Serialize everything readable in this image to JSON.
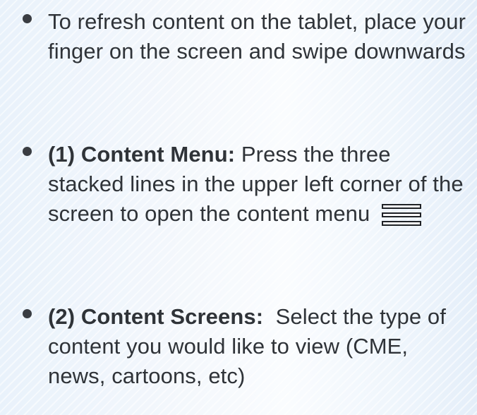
{
  "bullets": [
    {
      "lead": "",
      "text": "To refresh content on the tablet, place your finger on the screen and swipe downwards"
    },
    {
      "lead": "(1) Content Menu:",
      "text": " Press the three stacked lines in the upper left corner of the screen to open the content menu",
      "icon": "hamburger-menu-icon"
    },
    {
      "lead": "(2) Content Screens:",
      "text": "  Select the type of content you would like to view (CME, news, cartoons, etc)"
    }
  ]
}
